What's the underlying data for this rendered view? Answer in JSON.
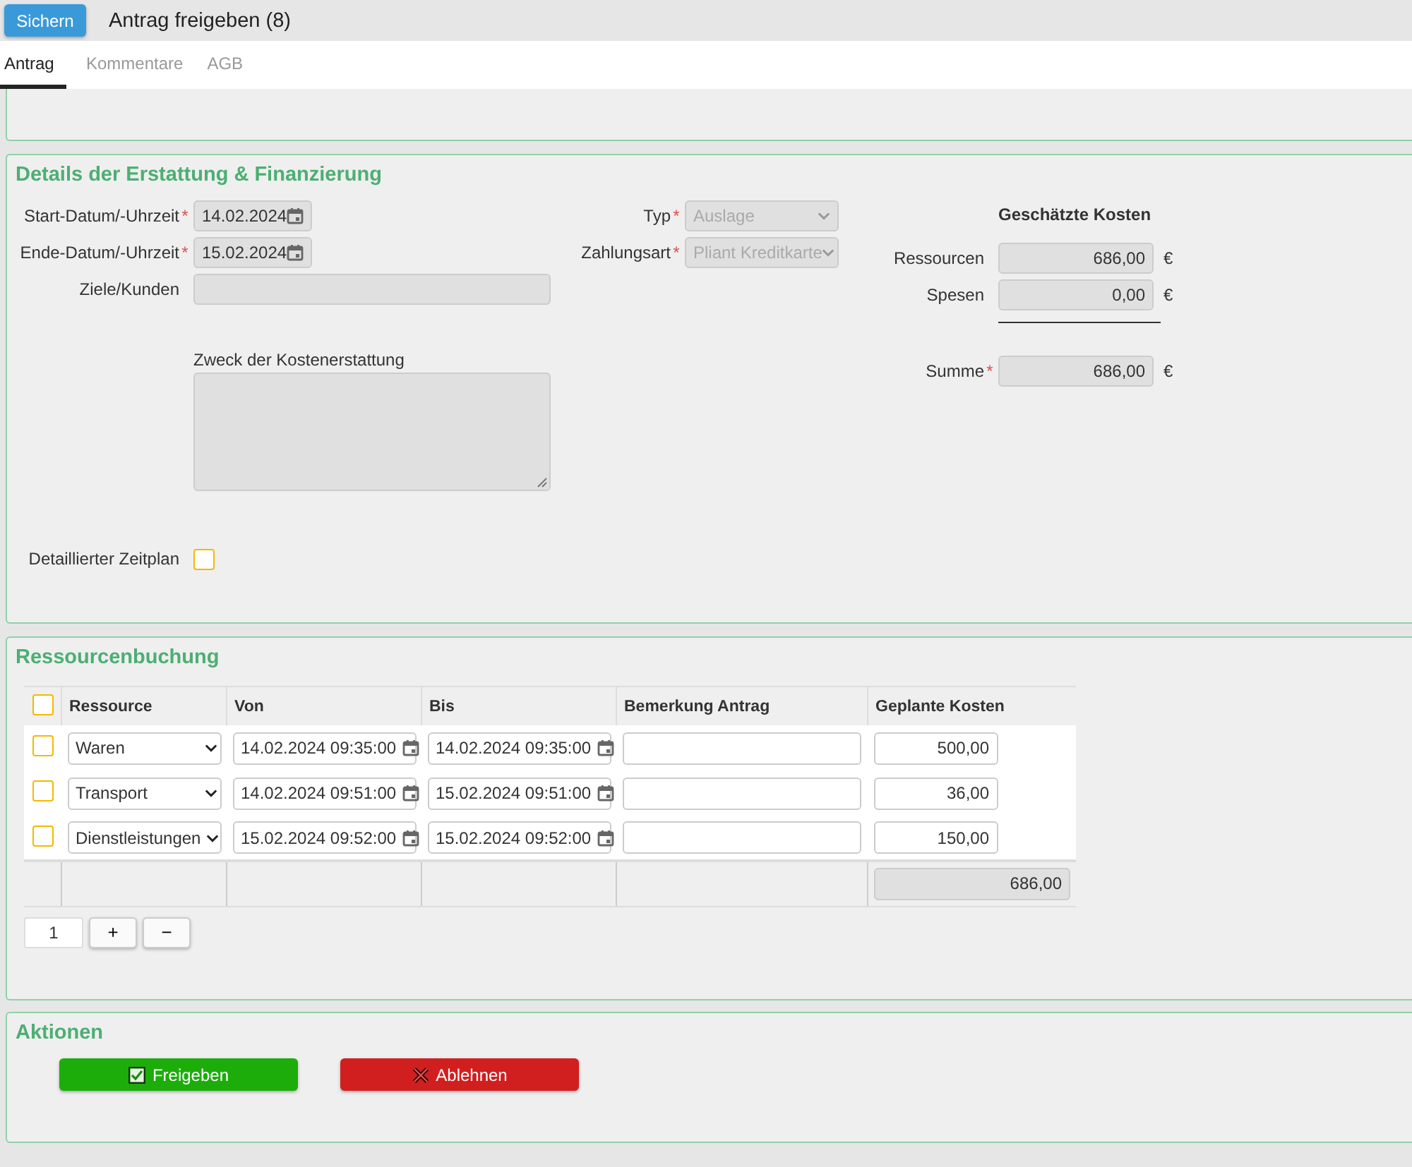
{
  "header": {
    "save_button": "Sichern",
    "title": "Antrag freigeben (8)"
  },
  "tabs": [
    {
      "label": "Antrag",
      "selected": true
    },
    {
      "label": "Kommentare",
      "selected": false
    },
    {
      "label": "AGB",
      "selected": false
    }
  ],
  "details": {
    "title": "Details der Erstattung & Finanzierung",
    "left_fields": [
      {
        "label": "Start-Datum/-Uhrzeit",
        "required_mark": "*",
        "kind": "date",
        "value": "14.02.2024"
      },
      {
        "label": "Ende-Datum/-Uhrzeit",
        "required_mark": "*",
        "kind": "date",
        "value": "15.02.2024"
      },
      {
        "label": "Ziele/Kunden",
        "kind": "text"
      }
    ],
    "purpose_label": "Zweck der Kostenerstattung",
    "schedule": {
      "label": "Detaillierter Zeitplan",
      "checked": false
    },
    "middle_fields": [
      {
        "label": "Typ",
        "required_mark": "*",
        "value": "Auslage",
        "disabled": true
      },
      {
        "label": "Zahlungsart",
        "required_mark": "*",
        "value": "Pliant Kreditkarte",
        "disabled": true
      }
    ],
    "costs": {
      "title": "Geschätzte Kosten",
      "rows": [
        {
          "label": "Ressourcen",
          "value": "686,00",
          "currency": "€"
        },
        {
          "label": "Spesen",
          "value": "0,00",
          "currency": "€"
        }
      ],
      "total": {
        "label": "Summe",
        "required_mark": "*",
        "value": "686,00",
        "currency": "€"
      }
    }
  },
  "booking": {
    "title": "Ressourcenbuchung",
    "select_all_checked": false,
    "columns": [
      "Ressource",
      "Von",
      "Bis",
      "Bemerkung Antrag",
      "Geplante Kosten"
    ],
    "rows": [
      {
        "checked": false,
        "resource": "Waren",
        "from": "14.02.2024 09:35:00",
        "to": "14.02.2024 09:35:00",
        "cost": "500,00"
      },
      {
        "checked": false,
        "resource": "Transport",
        "from": "14.02.2024 09:51:00",
        "to": "15.02.2024 09:51:00",
        "cost": "36,00"
      },
      {
        "checked": false,
        "resource": "Dienstleistungen",
        "from": "15.02.2024 09:52:00",
        "to": "15.02.2024 09:52:00",
        "cost": "150,00"
      }
    ],
    "total": "686,00",
    "row_count": "1",
    "add_button": "+",
    "remove_button": "−"
  },
  "actions": {
    "title": "Aktionen",
    "buttons": [
      {
        "label": "Freigeben",
        "kind": "approve"
      },
      {
        "label": "Ablehnen",
        "kind": "reject"
      }
    ]
  }
}
